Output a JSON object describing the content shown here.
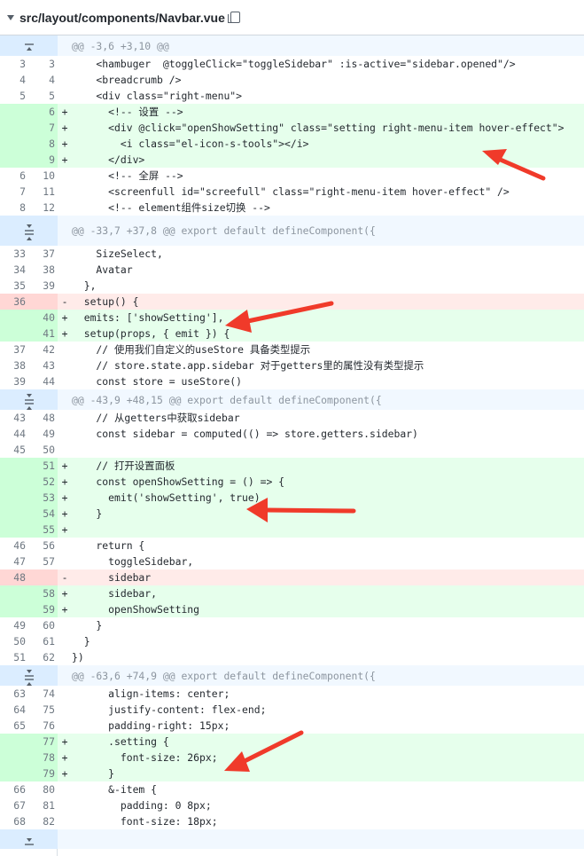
{
  "file": {
    "path": "src/layout/components/Navbar.vue"
  },
  "hunks": [
    {
      "header": "@@ -3,6 +3,10 @@",
      "icon": "expand-up-icon"
    },
    {
      "header": "@@ -33,7 +37,8 @@ export default defineComponent({",
      "icon": "expand-both-icon"
    },
    {
      "header": "@@ -43,9 +48,15 @@ export default defineComponent({",
      "icon": "expand-both-icon"
    },
    {
      "header": "@@ -63,6 +74,9 @@ export default defineComponent({",
      "icon": "expand-both-icon"
    }
  ],
  "lines": {
    "h1": [
      {
        "o": "3",
        "n": "3",
        "t": "ctx",
        "c": "    <hambuger  @toggleClick=\"toggleSidebar\" :is-active=\"sidebar.opened\"/>"
      },
      {
        "o": "4",
        "n": "4",
        "t": "ctx",
        "c": "    <breadcrumb />"
      },
      {
        "o": "5",
        "n": "5",
        "t": "ctx",
        "c": "    <div class=\"right-menu\">"
      },
      {
        "o": "",
        "n": "6",
        "t": "add",
        "c": "      <!-- 设置 -->"
      },
      {
        "o": "",
        "n": "7",
        "t": "add",
        "c": "      <div @click=\"openShowSetting\" class=\"setting right-menu-item hover-effect\">"
      },
      {
        "o": "",
        "n": "8",
        "t": "add",
        "c": "        <i class=\"el-icon-s-tools\"></i>"
      },
      {
        "o": "",
        "n": "9",
        "t": "add",
        "c": "      </div>"
      },
      {
        "o": "6",
        "n": "10",
        "t": "ctx",
        "c": "      <!-- 全屏 -->"
      },
      {
        "o": "7",
        "n": "11",
        "t": "ctx",
        "c": "      <screenfull id=\"screefull\" class=\"right-menu-item hover-effect\" />"
      },
      {
        "o": "8",
        "n": "12",
        "t": "ctx",
        "c": "      <!-- element组件size切换 -->"
      }
    ],
    "h2": [
      {
        "o": "33",
        "n": "37",
        "t": "ctx",
        "c": "    SizeSelect,"
      },
      {
        "o": "34",
        "n": "38",
        "t": "ctx",
        "c": "    Avatar"
      },
      {
        "o": "35",
        "n": "39",
        "t": "ctx",
        "c": "  },"
      },
      {
        "o": "36",
        "n": "",
        "t": "del",
        "c": "  setup() {"
      },
      {
        "o": "",
        "n": "40",
        "t": "add",
        "c": "  emits: ['showSetting'],"
      },
      {
        "o": "",
        "n": "41",
        "t": "add",
        "c": "  setup(props, { emit }) {"
      },
      {
        "o": "37",
        "n": "42",
        "t": "ctx",
        "c": "    // 使用我们自定义的useStore 具备类型提示"
      },
      {
        "o": "38",
        "n": "43",
        "t": "ctx",
        "c": "    // store.state.app.sidebar 对于getters里的属性没有类型提示"
      },
      {
        "o": "39",
        "n": "44",
        "t": "ctx",
        "c": "    const store = useStore()"
      }
    ],
    "h3": [
      {
        "o": "43",
        "n": "48",
        "t": "ctx",
        "c": "    // 从getters中获取sidebar"
      },
      {
        "o": "44",
        "n": "49",
        "t": "ctx",
        "c": "    const sidebar = computed(() => store.getters.sidebar)"
      },
      {
        "o": "45",
        "n": "50",
        "t": "ctx",
        "c": ""
      },
      {
        "o": "",
        "n": "51",
        "t": "add",
        "c": "    // 打开设置面板"
      },
      {
        "o": "",
        "n": "52",
        "t": "add",
        "c": "    const openShowSetting = () => {"
      },
      {
        "o": "",
        "n": "53",
        "t": "add",
        "c": "      emit('showSetting', true)"
      },
      {
        "o": "",
        "n": "54",
        "t": "add",
        "c": "    }"
      },
      {
        "o": "",
        "n": "55",
        "t": "add",
        "c": ""
      },
      {
        "o": "46",
        "n": "56",
        "t": "ctx",
        "c": "    return {"
      },
      {
        "o": "47",
        "n": "57",
        "t": "ctx",
        "c": "      toggleSidebar,"
      },
      {
        "o": "48",
        "n": "",
        "t": "del",
        "c": "      sidebar"
      },
      {
        "o": "",
        "n": "58",
        "t": "add",
        "c": "      sidebar,"
      },
      {
        "o": "",
        "n": "59",
        "t": "add",
        "c": "      openShowSetting"
      },
      {
        "o": "49",
        "n": "60",
        "t": "ctx",
        "c": "    }"
      },
      {
        "o": "50",
        "n": "61",
        "t": "ctx",
        "c": "  }"
      },
      {
        "o": "51",
        "n": "62",
        "t": "ctx",
        "c": "})"
      }
    ],
    "h4": [
      {
        "o": "63",
        "n": "74",
        "t": "ctx",
        "c": "      align-items: center;"
      },
      {
        "o": "64",
        "n": "75",
        "t": "ctx",
        "c": "      justify-content: flex-end;"
      },
      {
        "o": "65",
        "n": "76",
        "t": "ctx",
        "c": "      padding-right: 15px;"
      },
      {
        "o": "",
        "n": "77",
        "t": "add",
        "c": "      .setting {"
      },
      {
        "o": "",
        "n": "78",
        "t": "add",
        "c": "        font-size: 26px;"
      },
      {
        "o": "",
        "n": "79",
        "t": "add",
        "c": "      }"
      },
      {
        "o": "66",
        "n": "80",
        "t": "ctx",
        "c": "      &-item {"
      },
      {
        "o": "67",
        "n": "81",
        "t": "ctx",
        "c": "        padding: 0 8px;"
      },
      {
        "o": "68",
        "n": "82",
        "t": "ctx",
        "c": "        font-size: 18px;"
      }
    ]
  },
  "bottom": {
    "icon": "expand-down-icon"
  },
  "colors": {
    "add_bg": "#e6ffec",
    "del_bg": "#ffebe9",
    "hunk_bg": "#f1f8ff",
    "arrow": "#f03a2a"
  }
}
